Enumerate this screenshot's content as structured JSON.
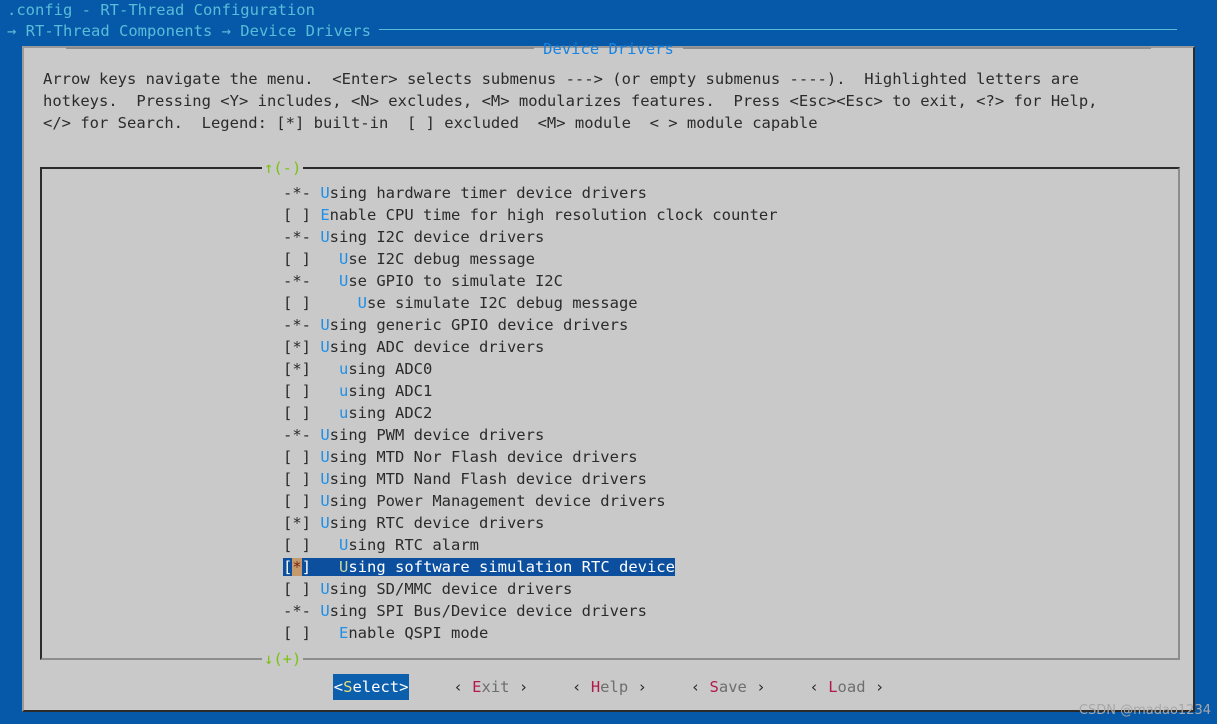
{
  "window": {
    "app_title": ".config - RT-Thread Configuration",
    "breadcrumb_arrow": "→",
    "breadcrumb": "→ RT-Thread Components → Device Drivers"
  },
  "dialog": {
    "title": "Device Drivers",
    "help_lines": [
      "Arrow keys navigate the menu.  <Enter> selects submenus ---> (or empty submenus ----).  Highlighted letters are",
      "hotkeys.  Pressing <Y> includes, <N> excludes, <M> modularizes features.  Press <Esc><Esc> to exit, <?> for Help,",
      "</> for Search.  Legend: [*] built-in  [ ] excluded  <M> module  < > module capable"
    ]
  },
  "menu": {
    "scroll_up": "↑(-)",
    "scroll_down": "↓(+)",
    "items": [
      {
        "mark": "-*-",
        "indent": "",
        "hotkey": "U",
        "rest": "sing hardware timer device drivers",
        "selected": false
      },
      {
        "mark": "[ ]",
        "indent": "",
        "hotkey": "E",
        "rest": "nable CPU time for high resolution clock counter",
        "selected": false
      },
      {
        "mark": "-*-",
        "indent": "",
        "hotkey": "U",
        "rest": "sing I2C device drivers",
        "selected": false
      },
      {
        "mark": "[ ]",
        "indent": "  ",
        "hotkey": "U",
        "rest": "se I2C debug message",
        "selected": false
      },
      {
        "mark": "-*-",
        "indent": "  ",
        "hotkey": "U",
        "rest": "se GPIO to simulate I2C",
        "selected": false
      },
      {
        "mark": "[ ]",
        "indent": "    ",
        "hotkey": "U",
        "rest": "se simulate I2C debug message",
        "selected": false
      },
      {
        "mark": "-*-",
        "indent": "",
        "hotkey": "U",
        "rest": "sing generic GPIO device drivers",
        "selected": false
      },
      {
        "mark": "[*]",
        "indent": "",
        "hotkey": "U",
        "rest": "sing ADC device drivers",
        "selected": false
      },
      {
        "mark": "[*]",
        "indent": "  ",
        "hotkey": "u",
        "rest": "sing ADC0",
        "selected": false
      },
      {
        "mark": "[ ]",
        "indent": "  ",
        "hotkey": "u",
        "rest": "sing ADC1",
        "selected": false
      },
      {
        "mark": "[ ]",
        "indent": "  ",
        "hotkey": "u",
        "rest": "sing ADC2",
        "selected": false
      },
      {
        "mark": "-*-",
        "indent": "",
        "hotkey": "U",
        "rest": "sing PWM device drivers",
        "selected": false
      },
      {
        "mark": "[ ]",
        "indent": "",
        "hotkey": "U",
        "rest": "sing MTD Nor Flash device drivers",
        "selected": false
      },
      {
        "mark": "[ ]",
        "indent": "",
        "hotkey": "U",
        "rest": "sing MTD Nand Flash device drivers",
        "selected": false
      },
      {
        "mark": "[ ]",
        "indent": "",
        "hotkey": "U",
        "rest": "sing Power Management device drivers",
        "selected": false
      },
      {
        "mark": "[*]",
        "indent": "",
        "hotkey": "U",
        "rest": "sing RTC device drivers",
        "selected": false
      },
      {
        "mark": "[ ]",
        "indent": "  ",
        "hotkey": "U",
        "rest": "sing RTC alarm",
        "selected": false
      },
      {
        "mark": "[*]",
        "indent": "  ",
        "hotkey": "U",
        "rest": "sing software simulation RTC device",
        "selected": true
      },
      {
        "mark": "[ ]",
        "indent": "",
        "hotkey": "U",
        "rest": "sing SD/MMC device drivers",
        "selected": false
      },
      {
        "mark": "-*-",
        "indent": "",
        "hotkey": "U",
        "rest": "sing SPI Bus/Device device drivers",
        "selected": false
      },
      {
        "mark": "[ ]",
        "indent": "  ",
        "hotkey": "E",
        "rest": "nable QSPI mode",
        "selected": false
      }
    ]
  },
  "buttons": [
    {
      "label": "Select",
      "hotkey": "S",
      "rest": "elect",
      "style": "angle",
      "active": true
    },
    {
      "label": "Exit",
      "hotkey": "E",
      "rest": "xit",
      "style": "wide",
      "active": false
    },
    {
      "label": "Help",
      "hotkey": "H",
      "rest": "elp",
      "style": "wide",
      "active": false
    },
    {
      "label": "Save",
      "hotkey": "S",
      "rest": "ave",
      "style": "wide",
      "active": false
    },
    {
      "label": "Load",
      "hotkey": "L",
      "rest": "oad",
      "style": "wide",
      "active": false
    }
  ],
  "watermark": "CSDN @madao1234",
  "colors": {
    "screen_bg": "#0659a8",
    "dialog_bg": "#c9c9c9",
    "title_text": "#59bcd8",
    "dialog_title": "#1883e0",
    "hotkey": "#1f8fe8",
    "selected_bg": "#0b4f9e",
    "cursor_bg": "#c49a6c",
    "scroll_marker": "#7bc214",
    "button_hotkey": "#b3194b"
  }
}
